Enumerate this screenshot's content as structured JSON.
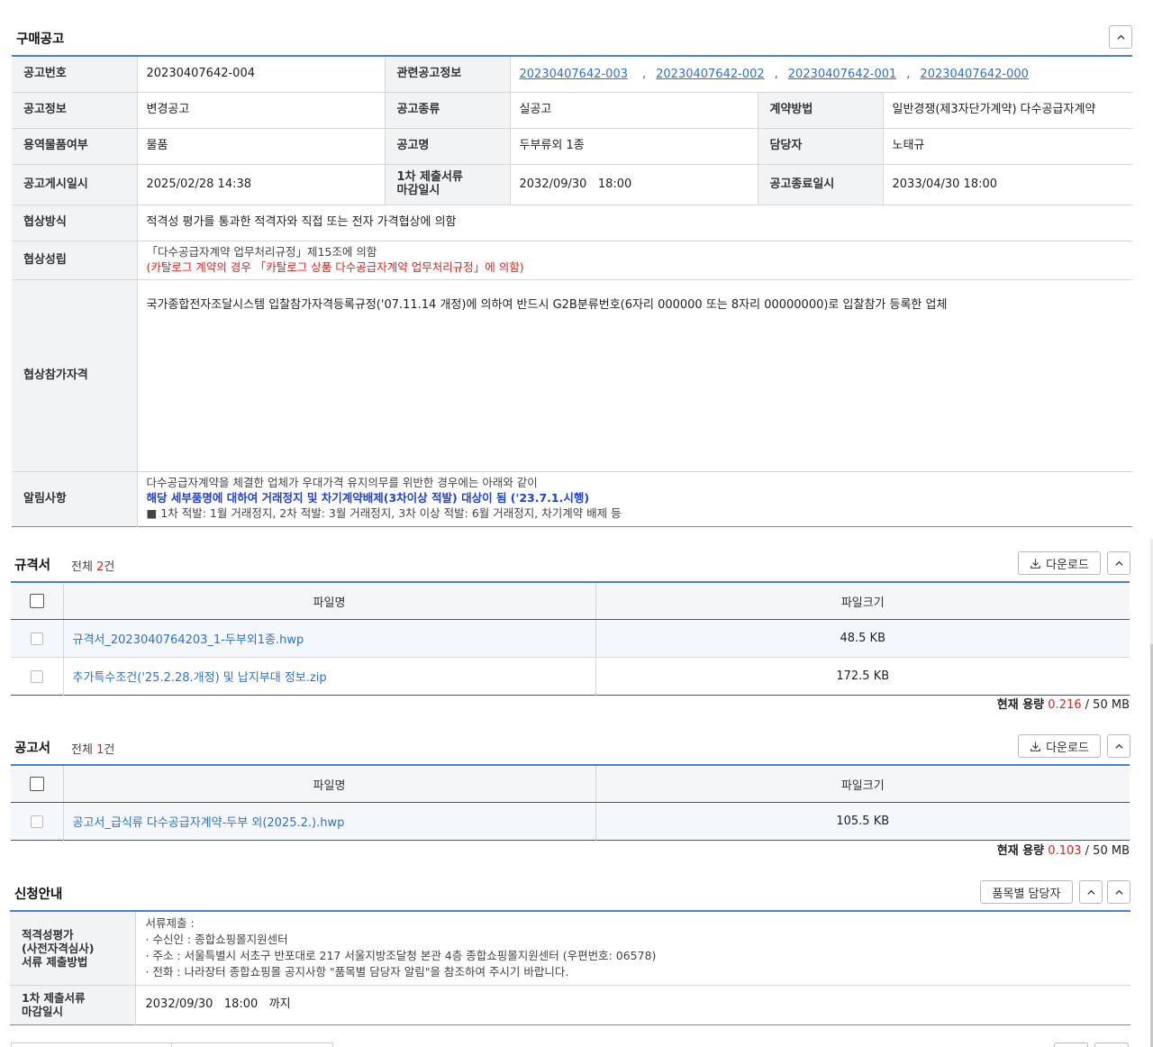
{
  "purchase_notice": {
    "title": "구매공고",
    "rows": {
      "notice_no_label": "공고번호",
      "notice_no": "20230407642-004",
      "related_label": "관련공고정보",
      "related_links": [
        "20230407642-003",
        "20230407642-002",
        "20230407642-001",
        "20230407642-000"
      ],
      "related_sep": ",",
      "info_label": "공고정보",
      "info_value": "변경공고",
      "type_label": "공고종류",
      "type_value": "실공고",
      "contract_label": "계약방법",
      "contract_value": "일반경쟁(제3자단가계약) 다수공급자계약",
      "goods_label": "용역물품여부",
      "goods_value": "물품",
      "name_label": "공고명",
      "name_value": "두부류외 1종",
      "manager_label": "담당자",
      "manager_value": "노태규",
      "posted_label": "공고게시일시",
      "posted_value": "2025/02/28 14:38",
      "deadline1_label_line1": "1차 제출서류",
      "deadline1_label_line2": "마감일시",
      "deadline1_value": "2032/09/30   18:00",
      "end_label": "공고종료일시",
      "end_value": "2033/04/30 18:00",
      "nego_method_label": "협상방식",
      "nego_method_value": "적격성 평가를 통과한 적격자와 직접 또는 전자 가격협상에 의함",
      "nego_est_label": "협상성립",
      "nego_est_line1": "「다수공급자계약 업무처리규정」제15조에 의함",
      "nego_est_line2": "(카탈로그 계약의 경우 「카탈로그 상품 다수공급자계약 업무처리규정」에 의함)",
      "qualification_label": "협상참가자격",
      "qualification_value": "국가종합전자조달시스템 입찰참가자격등록규정('07.11.14 개정)에 의하여 반드시 G2B분류번호(6자리 000000 또는 8자리 00000000)로 입찰참가 등록한 업체",
      "notice_label": "알림사항",
      "notice_line1": "다수공급자계약을 체결한 업체가 우대가격 유지의무를 위반한 경우에는 아래와 같이",
      "notice_line2": "해당 세부품명에 대하여 거래정지 및 차기계약배제(3차이상 적발) 대상이 됨 ('23.7.1.시행)",
      "notice_line3": "■ 1차 적발: 1월 거래정지, 2차 적발: 3월 거래정지, 3차 이상 적발: 6월 거래정지, 차기계약 배제 등"
    }
  },
  "spec_section": {
    "title": "규격서",
    "count_prefix": "전체 ",
    "count": "2",
    "count_suffix": "건",
    "download_label": "다운로드",
    "col_name": "파일명",
    "col_size": "파일크기",
    "files": [
      {
        "name": "규격서_2023040764203_1-두부외1종.hwp",
        "size": "48.5 KB"
      },
      {
        "name": "추가특수조건('25.2.28.개정) 및 납지부대 정보.zip",
        "size": "172.5 KB"
      }
    ],
    "usage_label": "현재 용량",
    "usage_value": "0.216",
    "usage_total": "/ 50",
    "usage_unit": "MB"
  },
  "notice_doc_section": {
    "title": "공고서",
    "count_prefix": "전체 ",
    "count": "1",
    "count_suffix": "건",
    "download_label": "다운로드",
    "col_name": "파일명",
    "col_size": "파일크기",
    "files": [
      {
        "name": "공고서_급식류 다수공급자계약-두부 외(2025.2.).hwp",
        "size": "105.5 KB"
      }
    ],
    "usage_label": "현재 용량",
    "usage_value": "0.103",
    "usage_total": "/ 50",
    "usage_unit": "MB"
  },
  "application_section": {
    "title": "신청안내",
    "manager_button": "품목별 담당자",
    "method_label_line1": "적격성평가",
    "method_label_line2": "(사전자격심사)",
    "method_label_line3": "서류 제출방법",
    "method_lines": [
      "서류제출 :",
      "· 수신인 : 종합쇼핑몰지원센터",
      "· 주소 : 서울특별시 서초구 반포대로 217 서울지방조달청 본관 4층 종합쇼핑몰지원센터 (우편번호: 06578)",
      "· 전화 : 나라장터 종합쇼핑몰 공지사항 \"품목별 담당자 알림\"을 참조하여 주시기 바랍니다."
    ],
    "deadline_label_line1": "1차 제출서류",
    "deadline_label_line2": "마감일시",
    "deadline_value": "2032/09/30   18:00",
    "deadline_suffix": "까지"
  },
  "icons": {
    "collapse": "chevron-up-icon",
    "download": "download-icon"
  },
  "colors": {
    "accent": "#4a7fd6",
    "link": "#2f6fd1",
    "alert_red": "#e0221b",
    "alert_blue": "#1f3fe0"
  }
}
